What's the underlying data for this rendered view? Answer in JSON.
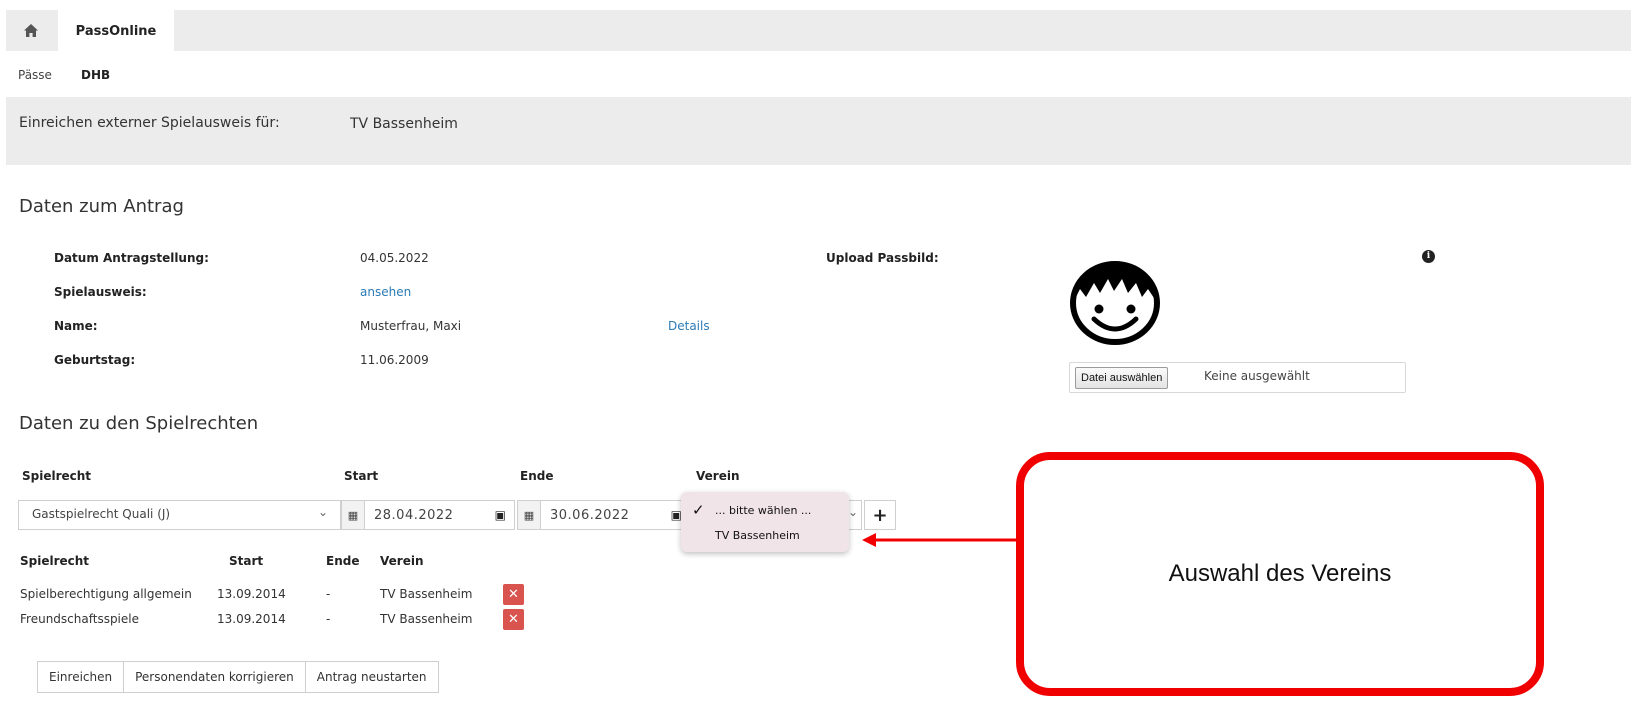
{
  "tabs": {
    "home_icon": "home-icon",
    "app": "PassOnline"
  },
  "breadcrumb": {
    "item1": "Pässe",
    "item2": "DHB"
  },
  "info": {
    "label": "Einreichen externer Spielausweis für:",
    "club": "TV Bassenheim"
  },
  "antrag": {
    "title": "Daten zum Antrag",
    "datum_label": "Datum Antragstellung:",
    "datum_value": "04.05.2022",
    "spielausweis_label": "Spielausweis:",
    "spielausweis_link": "ansehen",
    "name_label": "Name:",
    "name_value": "Musterfrau, Maxi",
    "details_link": "Details",
    "geburtstag_label": "Geburtstag:",
    "geburtstag_value": "11.06.2009",
    "upload_label": "Upload Passbild:",
    "upload_button": "Datei auswählen",
    "upload_status": "Keine ausgewählt"
  },
  "spielrechte": {
    "title": "Daten zu den Spielrechten",
    "form_headers": {
      "spielrecht": "Spielrecht",
      "start": "Start",
      "ende": "Ende",
      "verein": "Verein"
    },
    "spielrecht_selected": "Gastspielrecht Quali (J)",
    "start_date": "28.04.2022",
    "end_date": "30.06.2022",
    "verein_options": [
      "... bitte wählen ...",
      "TV Bassenheim"
    ],
    "table_headers": {
      "spielrecht": "Spielrecht",
      "start": "Start",
      "ende": "Ende",
      "verein": "Verein"
    },
    "rows": [
      {
        "spielrecht": "Spielberechtigung allgemein",
        "start": "13.09.2014",
        "ende": "-",
        "verein": "TV Bassenheim"
      },
      {
        "spielrecht": "Freundschaftsspiele",
        "start": "13.09.2014",
        "ende": "-",
        "verein": "TV Bassenheim"
      }
    ]
  },
  "actions": {
    "submit": "Einreichen",
    "correct": "Personendaten korrigieren",
    "restart": "Antrag neustarten"
  },
  "callout": {
    "text": "Auswahl des Vereins",
    "color": "#f00000"
  }
}
